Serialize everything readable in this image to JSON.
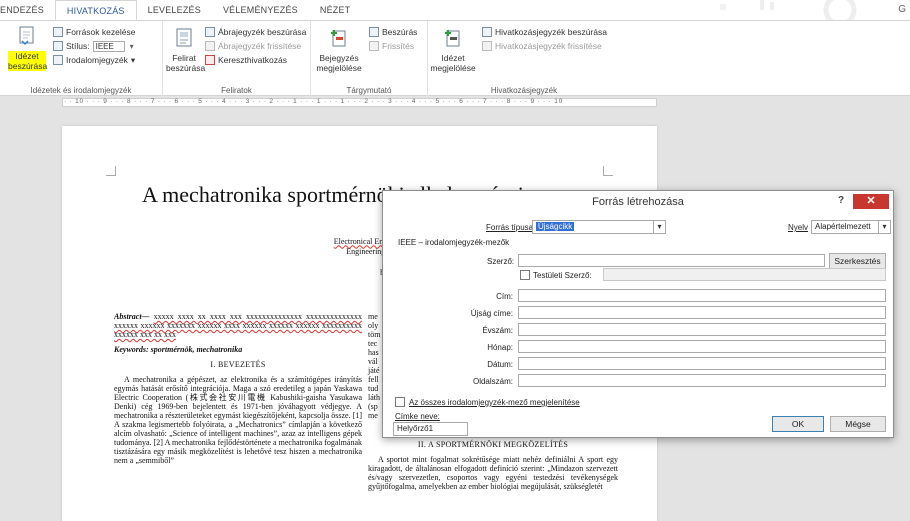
{
  "ribbon": {
    "tabs": [
      "ENDEZÉS",
      "HIVATKOZÁS",
      "LEVELEZÉS",
      "VÉLEMÉNYEZÉS",
      "NÉZET"
    ],
    "right_letter": "G",
    "citations": {
      "insert_label_1": "Idézet",
      "insert_label_2": "beszúrása",
      "manage_sources": "Források kezelése",
      "style_label": "Stílus:",
      "style_value": "IEEE",
      "bibliography": "Irodalomjegyzék",
      "group_label": "Idézetek és irodalomjegyzék"
    },
    "captions": {
      "insert_caption_1": "Felirat",
      "insert_caption_2": "beszúrása",
      "insert_toc_figures": "Ábrajegyzék beszúrása",
      "update_table": "Ábrajegyzék frissítése",
      "cross_reference": "Kereszthivatkozás",
      "group_label": "Feliratok"
    },
    "index": {
      "mark_entry_1": "Bejegyzés",
      "mark_entry_2": "megjelölése",
      "insert_index": "Beszúrás",
      "update_index": "Frissítés",
      "group_label": "Tárgymutató"
    },
    "authorities": {
      "mark_citation_1": "Idézet",
      "mark_citation_2": "megjelölése",
      "insert_table": "Hivatkozásjegyzék beszúrása",
      "update_table": "Hivatkozásjegyzék frissítése",
      "group_label": "Hivatkozásjegyzék"
    }
  },
  "ruler": {
    "text": "· · 10 · · · 9 · · · 8 · · · 7 · · · 6 · · · 5 · · · 4 · · · 3 · · · 2 · · · 1 · · · 1 · · · 1 · · · 2 · · · 3 · · · 4 · · · 5 · · · 6 · · · 7 · · · 8 · · · 9 · · · 10"
  },
  "document": {
    "title": "A mechatronika sportmérnöki alkalmazásai",
    "author_lines": [
      "Husi Géza",
      "Electronical Engineer and Mech",
      "Engineering Faculty, Univer",
      "Debrecen, Hun",
      "husigeza@eng.un"
    ],
    "abstract_label": "Abstract—",
    "abstract_text": "xxxxx xxxx xx xxxx xxx xxxxxxxxxxxxxx xxxxxxxxxxxxxx xxxxxx xxxxxx xxxxxxx xxxxxx xxxx xxxxxx xxxxxx xxxxxx xxxxxxxxxx xxxxxx xxx xx xxx",
    "keywords": "Keywords: sportmérnök, mechatronika",
    "section1_heading": "I.   BEVEZETÉS",
    "section1_text": "A mechatronika a gépészet, az elektronika és a számítógépes irányítás egymás hatását erősítő integrációja. Maga a szó eredetileg a japán Yaskawa Electric Cooperation (株式会社安川電機 Kabushiki-gaisha Yasukawa Denki) cég 1969-ben bejelentett és 1971-ben jóváhagyott védjegye. A mechatronika a részterületeket egymást kiegészítőjeként, kapcsolja össze. [1] A szakma legismertebb folyóirata, a „Mechatronics” címlapján a következő alcím olvasható: „Science of intelligent machines”, azaz az intelligens gépek tudománya. [2] A mechatronika fejlődéstörténete a mechatronika fogalmának tisztázására egy másik megközelítést is lehetővé tesz hiszen a mechatronika nem a „semmiből”",
    "col2_fragments": [
      "me",
      "oly",
      "töm",
      "tec",
      "has",
      "vál",
      "játé",
      "fell",
      "tud",
      "láth",
      "(sp",
      "me"
    ],
    "section2_heading": "II.   A SPORTMÉRNÖKI MEGKÖZELÍTÉS",
    "section2_text": "A sportot mint fogalmat sokrétűsége miatt nehéz definiálni A sport egy kiragadott, de általánosan elfogadott definíció szerint: „Mindazon szervezett és/vagy szervezetlen, csoportos vagy egyéni testedzési tevékenységek gyűjtőfogalma, amelyekben az ember biológiai megújulását, szükségletét"
  },
  "dialog": {
    "title": "Forrás létrehozása",
    "help": "?",
    "close": "✕",
    "source_type_label": "Forrás típusa:",
    "source_type_value": "Újságcikk",
    "language_label": "Nyelv",
    "language_value": "Alapértelmezett",
    "section_label": "IEEE – irodalomjegyzék-mezők",
    "author_label": "Szerző:",
    "edit_button": "Szerkesztés",
    "corporate_author_label": "Testületi Szerző:",
    "fields": [
      {
        "label": "Cím:",
        "value": ""
      },
      {
        "label": "Újság címe:",
        "value": ""
      },
      {
        "label": "Évszám:",
        "value": ""
      },
      {
        "label": "Hónap:",
        "value": ""
      },
      {
        "label": "Dátum:",
        "value": ""
      },
      {
        "label": "Oldalszám:",
        "value": ""
      }
    ],
    "show_all_label": "Az összes irodalomjegyzék-mező megjelenítése",
    "tag_name_label": "Címke neve:",
    "tag_name_value": "Helyőrző1",
    "ok": "OK",
    "cancel": "Mégse"
  }
}
